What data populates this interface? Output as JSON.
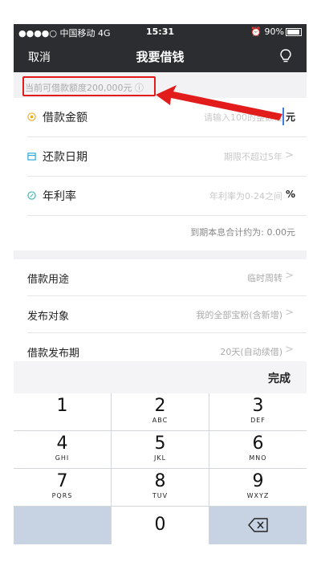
{
  "status_bar": {
    "carrier": "●●●●○ 中国移动",
    "network": "4G",
    "time": "15:31",
    "battery": "90%"
  },
  "nav": {
    "cancel": "取消",
    "title": "我要借钱",
    "bulb_icon": "lightbulb-icon"
  },
  "limit": {
    "text": "当前可借款额度200,000元 ⓘ"
  },
  "form": {
    "amount": {
      "label": "借款金额",
      "placeholder": "请输入100的整数倍",
      "unit": "元"
    },
    "date": {
      "label": "还款日期",
      "placeholder": "期限不超过5年",
      "chevron": ">"
    },
    "rate": {
      "label": "年利率",
      "placeholder": "年利率为0-24之间",
      "unit": "%"
    },
    "summary": "到期本息合计约为: 0.00元"
  },
  "options": [
    {
      "label": "借款用途",
      "value": "临时周转",
      "chevron": ">"
    },
    {
      "label": "发布对象",
      "value": "我的全部宝粉(含新增)",
      "chevron": ">"
    },
    {
      "label": "借款发布期",
      "value": "20天(自动续借)",
      "chevron": ">"
    }
  ],
  "keyboard": {
    "done": "完成",
    "keys": [
      {
        "digit": "1",
        "letters": ""
      },
      {
        "digit": "2",
        "letters": "ABC"
      },
      {
        "digit": "3",
        "letters": "DEF"
      },
      {
        "digit": "4",
        "letters": "GHI"
      },
      {
        "digit": "5",
        "letters": "JKL"
      },
      {
        "digit": "6",
        "letters": "MNO"
      },
      {
        "digit": "7",
        "letters": "PQRS"
      },
      {
        "digit": "8",
        "letters": "TUV"
      },
      {
        "digit": "9",
        "letters": "WXYZ"
      },
      {
        "digit": "0",
        "letters": ""
      }
    ],
    "delete_icon": "backspace-icon"
  },
  "colors": {
    "nav_bg": "#2c2d31",
    "annotation_red": "#e21b1b",
    "cursor_blue": "#3c7fe0",
    "amount_icon": "#e8b020",
    "date_icon": "#2aa8d8",
    "rate_icon": "#38b8b0"
  }
}
